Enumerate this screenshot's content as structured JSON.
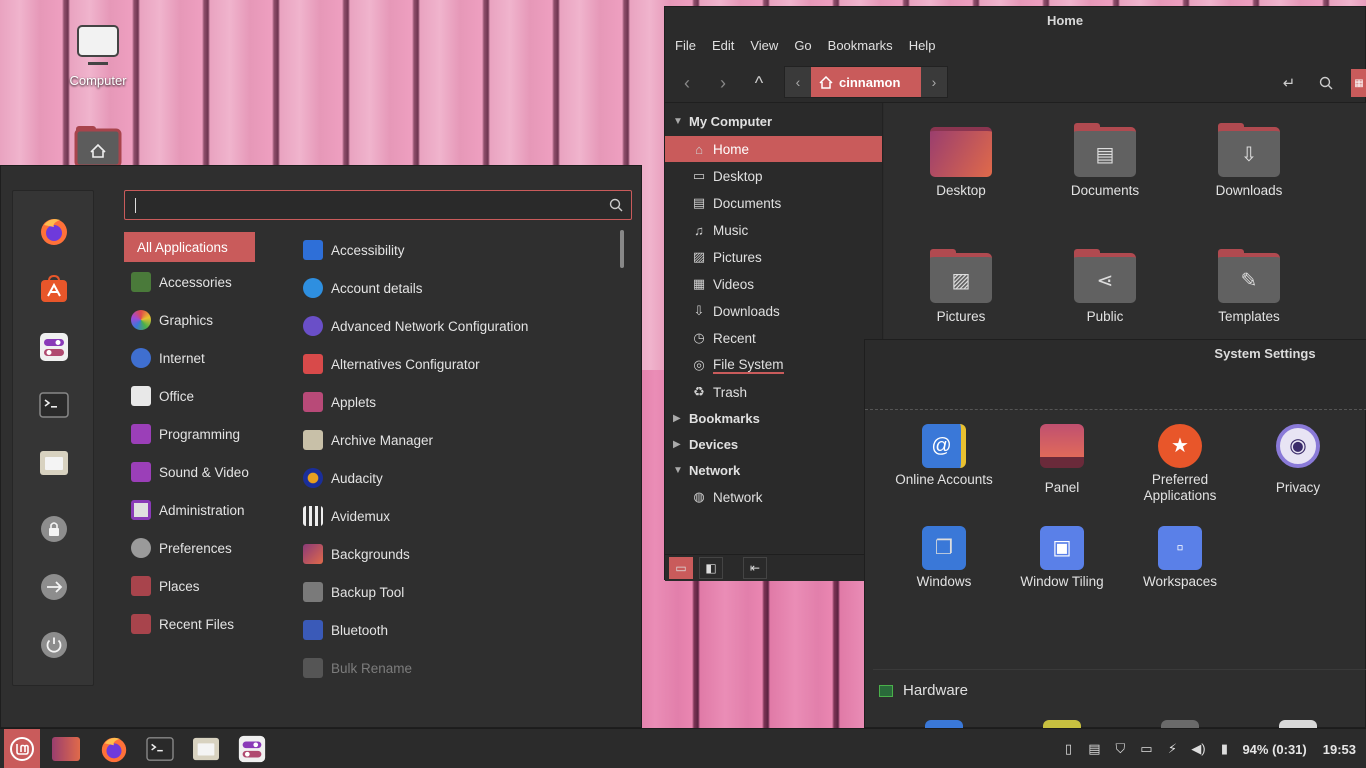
{
  "desktop": {
    "icons": [
      {
        "label": "Computer",
        "icon": "computer-icon"
      },
      {
        "label": "",
        "icon": "home-folder-icon"
      }
    ]
  },
  "menu": {
    "search": {
      "value": "",
      "placeholder": ""
    },
    "favorites": [
      {
        "name": "firefox-icon"
      },
      {
        "name": "software-manager-icon"
      },
      {
        "name": "settings-toggle-icon"
      },
      {
        "name": "terminal-icon"
      },
      {
        "name": "files-icon"
      },
      {
        "name": "lock-icon"
      },
      {
        "name": "logout-icon"
      },
      {
        "name": "power-icon"
      }
    ],
    "categories": [
      {
        "label": "All Applications",
        "color": "#c95b5b"
      },
      {
        "label": "Accessories",
        "color": "#4a7a3a"
      },
      {
        "label": "Graphics",
        "color": "#d9a030"
      },
      {
        "label": "Internet",
        "color": "#3f6fd0"
      },
      {
        "label": "Office",
        "color": "#e8e8e8"
      },
      {
        "label": "Programming",
        "color": "#9b3fb8"
      },
      {
        "label": "Sound & Video",
        "color": "#9b3fb8"
      },
      {
        "label": "Administration",
        "color": "#d8d8d8"
      },
      {
        "label": "Preferences",
        "color": "#9a9a9a"
      },
      {
        "label": "Places",
        "color": "#a8444c"
      },
      {
        "label": "Recent Files",
        "color": "#a8444c"
      }
    ],
    "apps": [
      {
        "label": "Accessibility",
        "color": "#2e6fd8"
      },
      {
        "label": "Account details",
        "color": "#2e8fe0"
      },
      {
        "label": "Advanced Network Configuration",
        "color": "#6a4fc8"
      },
      {
        "label": "Alternatives Configurator",
        "color": "#d84a4a"
      },
      {
        "label": "Applets",
        "color": "#b84a78"
      },
      {
        "label": "Archive Manager",
        "color": "#c8c0a8"
      },
      {
        "label": "Audacity",
        "color": "#1a2e9a"
      },
      {
        "label": "Avidemux",
        "color": "#3a3a3a"
      },
      {
        "label": "Backgrounds",
        "color": "#b04a70"
      },
      {
        "label": "Backup Tool",
        "color": "#7a7a7a"
      },
      {
        "label": "Bluetooth",
        "color": "#3a5ab8"
      },
      {
        "label": "Bulk Rename",
        "color": "#555555"
      }
    ]
  },
  "file_manager": {
    "title": "Home",
    "menubar": [
      "File",
      "Edit",
      "View",
      "Go",
      "Bookmarks",
      "Help"
    ],
    "breadcrumb": "cinnamon",
    "sections": {
      "my_computer": "My Computer",
      "bookmarks": "Bookmarks",
      "devices": "Devices",
      "network": "Network"
    },
    "places": [
      {
        "label": "Home",
        "icon": "⌂"
      },
      {
        "label": "Desktop",
        "icon": "▭"
      },
      {
        "label": "Documents",
        "icon": "▤"
      },
      {
        "label": "Music",
        "icon": "♫"
      },
      {
        "label": "Pictures",
        "icon": "▨"
      },
      {
        "label": "Videos",
        "icon": "▦"
      },
      {
        "label": "Downloads",
        "icon": "⇩"
      },
      {
        "label": "Recent",
        "icon": "◷"
      },
      {
        "label": "File System",
        "icon": "◎"
      },
      {
        "label": "Trash",
        "icon": "♻"
      }
    ],
    "network_items": [
      {
        "label": "Network",
        "icon": "◍"
      }
    ],
    "folders": [
      {
        "label": "Desktop",
        "glyph": ""
      },
      {
        "label": "Documents",
        "glyph": "▤"
      },
      {
        "label": "Downloads",
        "glyph": "⇩"
      },
      {
        "label": "Pictures",
        "glyph": "▨"
      },
      {
        "label": "Public",
        "glyph": "⋖"
      },
      {
        "label": "Templates",
        "glyph": "✎"
      }
    ]
  },
  "system_settings": {
    "title": "System Settings",
    "items": [
      {
        "label": "Online Accounts",
        "glyph": "@",
        "color": "#3a78d8"
      },
      {
        "label": "Panel",
        "glyph": "",
        "color": "#b0506a"
      },
      {
        "label": "Preferred Applications",
        "glyph": "★",
        "color": "#e8562a"
      },
      {
        "label": "Privacy",
        "glyph": "◉",
        "color": "#8a7ad8"
      },
      {
        "label": "Windows",
        "glyph": "❐",
        "color": "#3a78d8"
      },
      {
        "label": "Window Tiling",
        "glyph": "▣",
        "color": "#5a80e8"
      },
      {
        "label": "Workspaces",
        "glyph": "▫",
        "color": "#5a80e8"
      }
    ],
    "section": "Hardware"
  },
  "taskbar": {
    "apps": [
      "mint-menu-icon",
      "desktop-show-icon",
      "firefox-icon",
      "terminal-icon",
      "files-icon",
      "settings-toggle-icon"
    ],
    "battery": "94% (0:31)",
    "clock": "19:53"
  }
}
